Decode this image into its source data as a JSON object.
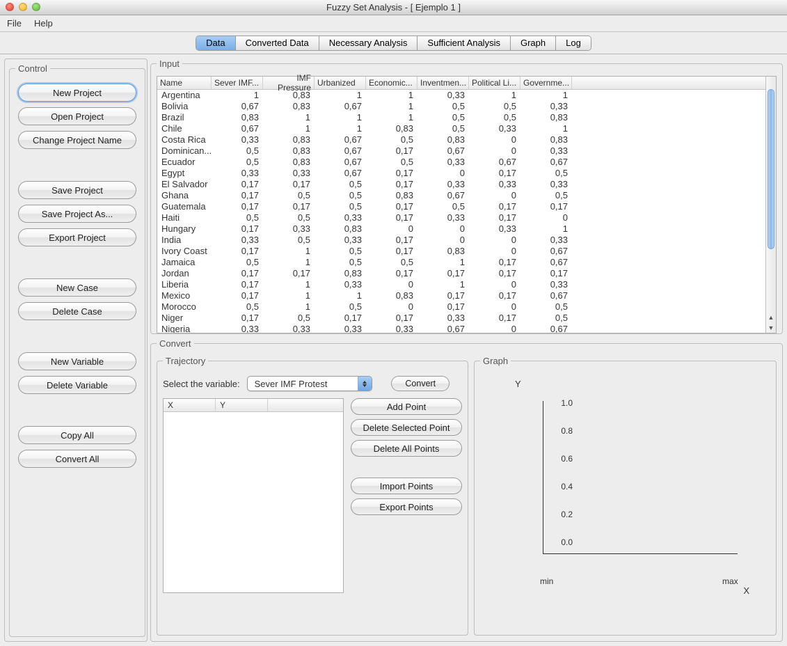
{
  "window": {
    "title": "Fuzzy Set Analysis - [ Ejemplo 1 ]"
  },
  "menubar": {
    "file": "File",
    "help": "Help"
  },
  "tabs": {
    "data": "Data",
    "converted": "Converted Data",
    "necessary": "Necessary Analysis",
    "sufficient": "Sufficient Analysis",
    "graph": "Graph",
    "log": "Log"
  },
  "control": {
    "legend": "Control",
    "new_project": "New Project",
    "open_project": "Open Project",
    "change_name": "Change Project Name",
    "save_project": "Save Project",
    "save_project_as": "Save Project As...",
    "export_project": "Export Project",
    "new_case": "New Case",
    "delete_case": "Delete Case",
    "new_variable": "New Variable",
    "delete_variable": "Delete Variable",
    "copy_all": "Copy All",
    "convert_all": "Convert All"
  },
  "input": {
    "legend": "Input",
    "headers": [
      "Name",
      "Sever IMF...",
      "IMF Pressure",
      "Urbanized",
      "Economic...",
      "Inventmen...",
      "Political Li...",
      "Governme..."
    ],
    "rows": [
      [
        "Argentina",
        "1",
        "0,83",
        "1",
        "1",
        "0,33",
        "1",
        "1"
      ],
      [
        "Bolivia",
        "0,67",
        "0,83",
        "0,67",
        "1",
        "0,5",
        "0,5",
        "0,33"
      ],
      [
        "Brazil",
        "0,83",
        "1",
        "1",
        "1",
        "0,5",
        "0,5",
        "0,83"
      ],
      [
        "Chile",
        "0,67",
        "1",
        "1",
        "0,83",
        "0,5",
        "0,33",
        "1"
      ],
      [
        "Costa Rica",
        "0,33",
        "0,83",
        "0,67",
        "0,5",
        "0,83",
        "0",
        "0,83"
      ],
      [
        "Dominican...",
        "0,5",
        "0,83",
        "0,67",
        "0,17",
        "0,67",
        "0",
        "0,33"
      ],
      [
        "Ecuador",
        "0,5",
        "0,83",
        "0,67",
        "0,5",
        "0,33",
        "0,67",
        "0,67"
      ],
      [
        "Egypt",
        "0,33",
        "0,33",
        "0,67",
        "0,17",
        "0",
        "0,17",
        "0,5"
      ],
      [
        "El Salvador",
        "0,17",
        "0,17",
        "0,5",
        "0,17",
        "0,33",
        "0,33",
        "0,33"
      ],
      [
        "Ghana",
        "0,17",
        "0,5",
        "0,5",
        "0,83",
        "0,67",
        "0",
        "0,5"
      ],
      [
        "Guatemala",
        "0,17",
        "0,17",
        "0,5",
        "0,17",
        "0,5",
        "0,17",
        "0,17"
      ],
      [
        "Haiti",
        "0,5",
        "0,5",
        "0,33",
        "0,17",
        "0,33",
        "0,17",
        "0"
      ],
      [
        "Hungary",
        "0,17",
        "0,33",
        "0,83",
        "0",
        "0",
        "0,33",
        "1"
      ],
      [
        "India",
        "0,33",
        "0,5",
        "0,33",
        "0,17",
        "0",
        "0",
        "0,33"
      ],
      [
        "Ivory Coast",
        "0,17",
        "1",
        "0,5",
        "0,17",
        "0,83",
        "0",
        "0,67"
      ],
      [
        "Jamaica",
        "0,5",
        "1",
        "0,5",
        "0,5",
        "1",
        "0,17",
        "0,67"
      ],
      [
        "Jordan",
        "0,17",
        "0,17",
        "0,83",
        "0,17",
        "0,17",
        "0,17",
        "0,17"
      ],
      [
        "Liberia",
        "0,17",
        "1",
        "0,33",
        "0",
        "1",
        "0",
        "0,33"
      ],
      [
        "Mexico",
        "0,17",
        "1",
        "1",
        "0,83",
        "0,17",
        "0,17",
        "0,67"
      ],
      [
        "Morocco",
        "0,5",
        "1",
        "0,5",
        "0",
        "0,17",
        "0",
        "0,5"
      ],
      [
        "Niger",
        "0,17",
        "0,5",
        "0,17",
        "0,17",
        "0,33",
        "0,17",
        "0,5"
      ],
      [
        "Nigeria",
        "0,33",
        "0,33",
        "0,33",
        "0,33",
        "0,67",
        "0",
        "0,67"
      ]
    ]
  },
  "convert": {
    "legend": "Convert",
    "trajectory_legend": "Trajectory",
    "select_label": "Select the variable:",
    "selected_variable": "Sever IMF Protest",
    "convert_btn": "Convert",
    "points_headers": {
      "x": "X",
      "y": "Y"
    },
    "add_point": "Add Point",
    "delete_selected": "Delete Selected Point",
    "delete_all": "Delete All Points",
    "import_points": "Import Points",
    "export_points": "Export Points",
    "graph_legend": "Graph",
    "axis_y": "Y",
    "axis_x": "X",
    "yticks": {
      "t10": "1.0",
      "t08": "0.8",
      "t06": "0.6",
      "t04": "0.4",
      "t02": "0.2",
      "t00": "0.0"
    },
    "xmin": "min",
    "xmax": "max"
  }
}
